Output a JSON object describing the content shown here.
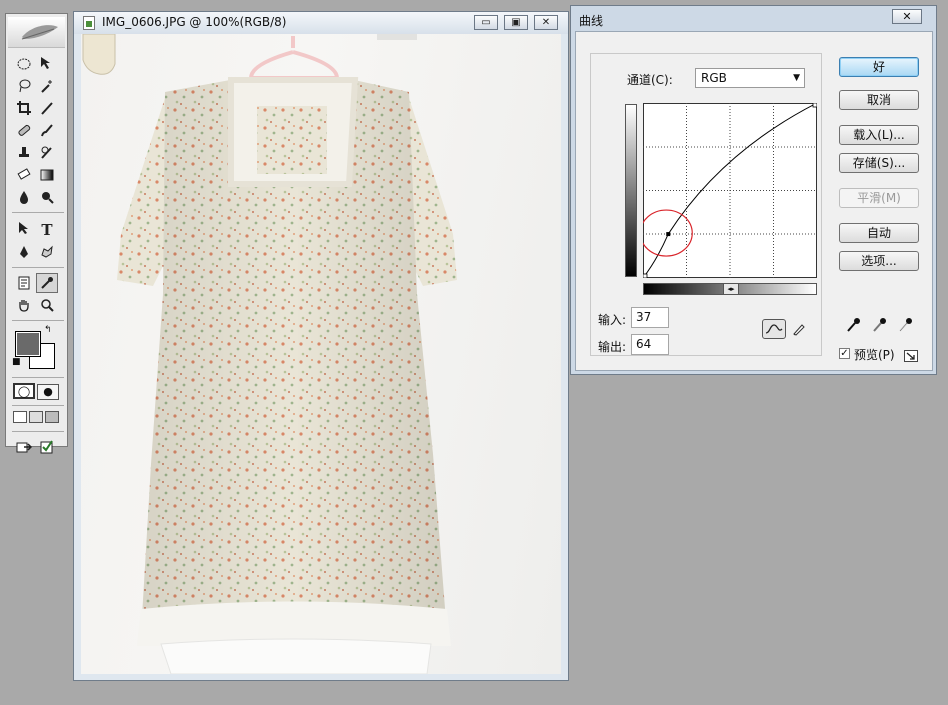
{
  "image_window": {
    "title": "IMG_0606.JPG @ 100%(RGB/8)",
    "minimize_label": "▭",
    "restore_label": "▣",
    "close_label": "✕"
  },
  "dialog": {
    "title": "曲线",
    "close_label": "✕",
    "channel_label": "通道(C):",
    "channel_value": "RGB",
    "input_label": "输入:",
    "input_value": "37",
    "output_label": "输出:",
    "output_value": "64",
    "buttons": {
      "ok": "好",
      "cancel": "取消",
      "load": "载入(L)...",
      "save": "存储(S)...",
      "smooth": "平滑(M)",
      "auto": "自动",
      "options": "选项..."
    },
    "preview_label": "预览(P)",
    "preview_checked": true,
    "preview_check_mark": "✓",
    "hgrad_marker": "◂▸",
    "curve_point": {
      "input": 37,
      "output": 64
    },
    "curve_color": "#000000",
    "annotation_color": "#d9242a"
  },
  "toolbox": {
    "foreground_color": "#6a6a6a",
    "background_color": "#ffffff"
  }
}
